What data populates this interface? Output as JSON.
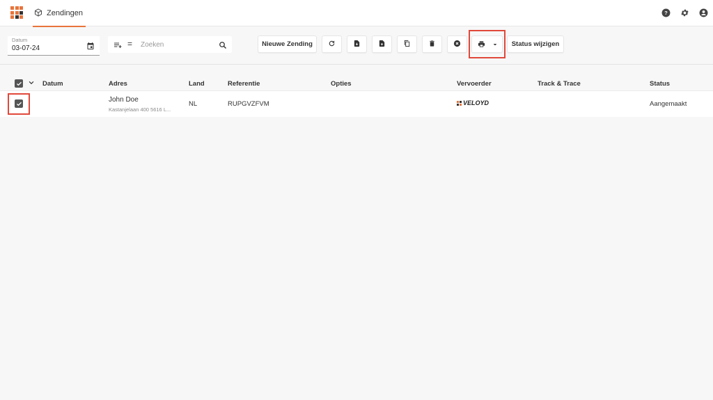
{
  "app": {
    "tab_label": "Zendingen"
  },
  "colors": {
    "accent": "#e8743b",
    "highlight": "#e0483a",
    "logo": [
      "#e8743b",
      "#e8743b",
      "#e8743b",
      "#e8743b",
      "#e8743b",
      "#333333",
      "#e8743b",
      "#333333",
      "#e8743b"
    ]
  },
  "topbar": {
    "icons": [
      "help-icon",
      "gear-icon",
      "account-icon"
    ]
  },
  "filters": {
    "date": {
      "label": "Datum",
      "value": "03-07-24"
    },
    "search": {
      "placeholder": "Zoeken"
    }
  },
  "toolbar": {
    "new_shipment": "Nieuwe Zending",
    "change_status": "Status wijzigen",
    "icons": [
      "refresh-icon",
      "download-document-icon",
      "upload-document-icon",
      "copy-icon",
      "delete-icon",
      "cancel-icon",
      "print-icon",
      "dropdown-arrow-icon"
    ]
  },
  "table": {
    "columns": [
      "Datum",
      "Adres",
      "Land",
      "Referentie",
      "Opties",
      "Vervoerder",
      "Track & Trace",
      "Status"
    ],
    "rows": [
      {
        "checked": true,
        "datum": "",
        "name": "John Doe",
        "address": "Kastanjelaan 400 5616 L...",
        "land": "NL",
        "referentie": "RUPGVZFVM",
        "opties": "",
        "vervoerder": "VELOYD",
        "track_trace": "",
        "status": "Aangemaakt"
      }
    ]
  }
}
